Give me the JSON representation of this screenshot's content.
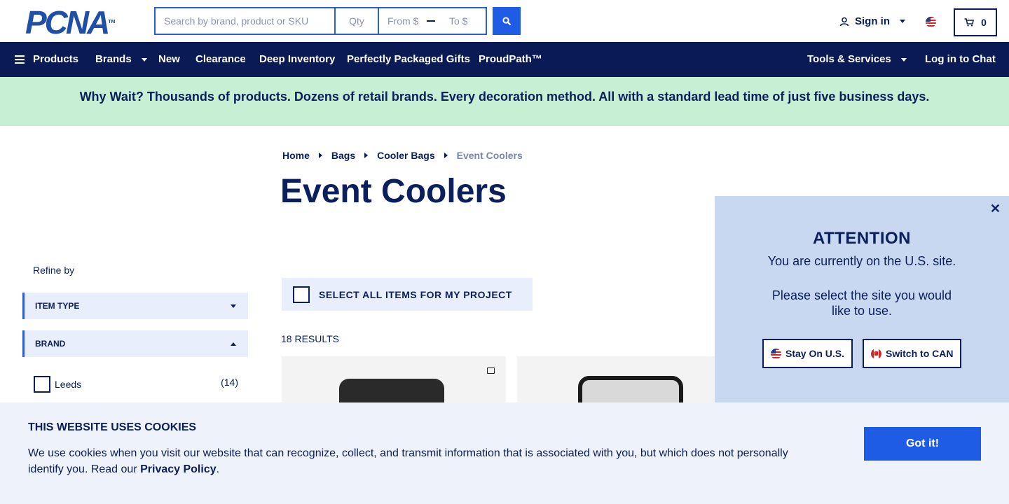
{
  "header": {
    "logo_text": "PCNA",
    "logo_tm": "TM",
    "search_placeholder": "Search by brand, product or SKU",
    "qty_placeholder": "Qty",
    "from_placeholder": "From $",
    "to_placeholder": "To $",
    "signin_label": "Sign in",
    "cart_count": "0"
  },
  "nav": {
    "products": "Products",
    "brands": "Brands",
    "new": "New",
    "clearance": "Clearance",
    "deep_inventory": "Deep Inventory",
    "gifts": "Perfectly Packaged Gifts",
    "proudpath": "ProudPath™",
    "tools": "Tools & Services",
    "chat": "Log in to Chat"
  },
  "promo": {
    "text": "Why Wait? Thousands of products. Dozens of retail brands. Every decoration method. All with a standard lead time of just five business days."
  },
  "breadcrumb": [
    "Home",
    "Bags",
    "Cooler Bags",
    "Event Coolers"
  ],
  "page_title": "Event Coolers",
  "sidebar": {
    "refine_label": "Refine by",
    "facets": [
      {
        "label": "ITEM TYPE",
        "expanded": false
      },
      {
        "label": "BRAND",
        "expanded": true
      }
    ],
    "brand_options": [
      {
        "label": "Leeds",
        "count": "(14)"
      }
    ]
  },
  "results": {
    "select_all_label": "SELECT ALL ITEMS FOR MY PROJECT",
    "count_label": "18 RESULTS"
  },
  "popup": {
    "title": "ATTENTION",
    "line1": "You are currently on the U.S. site.",
    "line2": "Please select the site you would like to use.",
    "stay_label": "Stay On U.S.",
    "switch_label": "Switch to CAN",
    "close_glyph": "✕"
  },
  "cookie": {
    "title": "THIS WEBSITE USES COOKIES",
    "text": "We use cookies when you visit our website that can recognize, collect, and transmit information that is associated with you, but which does not personally identify you. Read our ",
    "link": "Privacy Policy",
    "text_end": ".",
    "button": "Got it!"
  },
  "colors": {
    "navy": "#0a1a54",
    "accent_blue": "#1f5ce6",
    "promo_green": "#c7efd4",
    "popup_bg": "#c8d8f0"
  }
}
